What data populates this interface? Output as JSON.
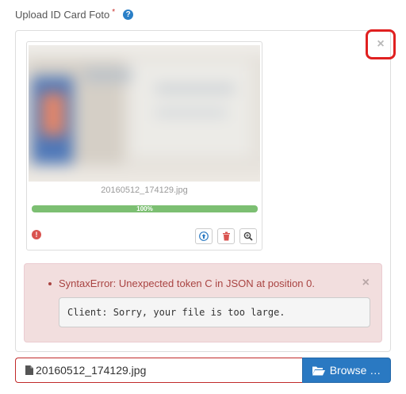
{
  "field": {
    "label": "Upload ID Card Foto",
    "required_mark": "*",
    "help_icon": "question-circle-icon"
  },
  "panel": {
    "close_icon": "close-icon",
    "close_glyph": "×",
    "highlight_color": "#e02020"
  },
  "preview": {
    "file_name": "20160512_174129.jpg",
    "progress_fraction": 1.0,
    "progress_label": "100%",
    "progress_color": "#7cbf72",
    "status_icon": "exclamation-circle-icon",
    "actions": [
      {
        "name": "upload-icon"
      },
      {
        "name": "trash-icon"
      },
      {
        "name": "zoom-icon"
      }
    ]
  },
  "alert": {
    "message": "SyntaxError: Unexpected token C in JSON at position 0.",
    "close_glyph": "×",
    "code": "Client: Sorry, your file is too large."
  },
  "file_input": {
    "value": "20160512_174129.jpg",
    "icon": "file-icon"
  },
  "browse": {
    "label": "Browse …",
    "icon": "folder-open-icon",
    "color": "#2a79c2"
  }
}
